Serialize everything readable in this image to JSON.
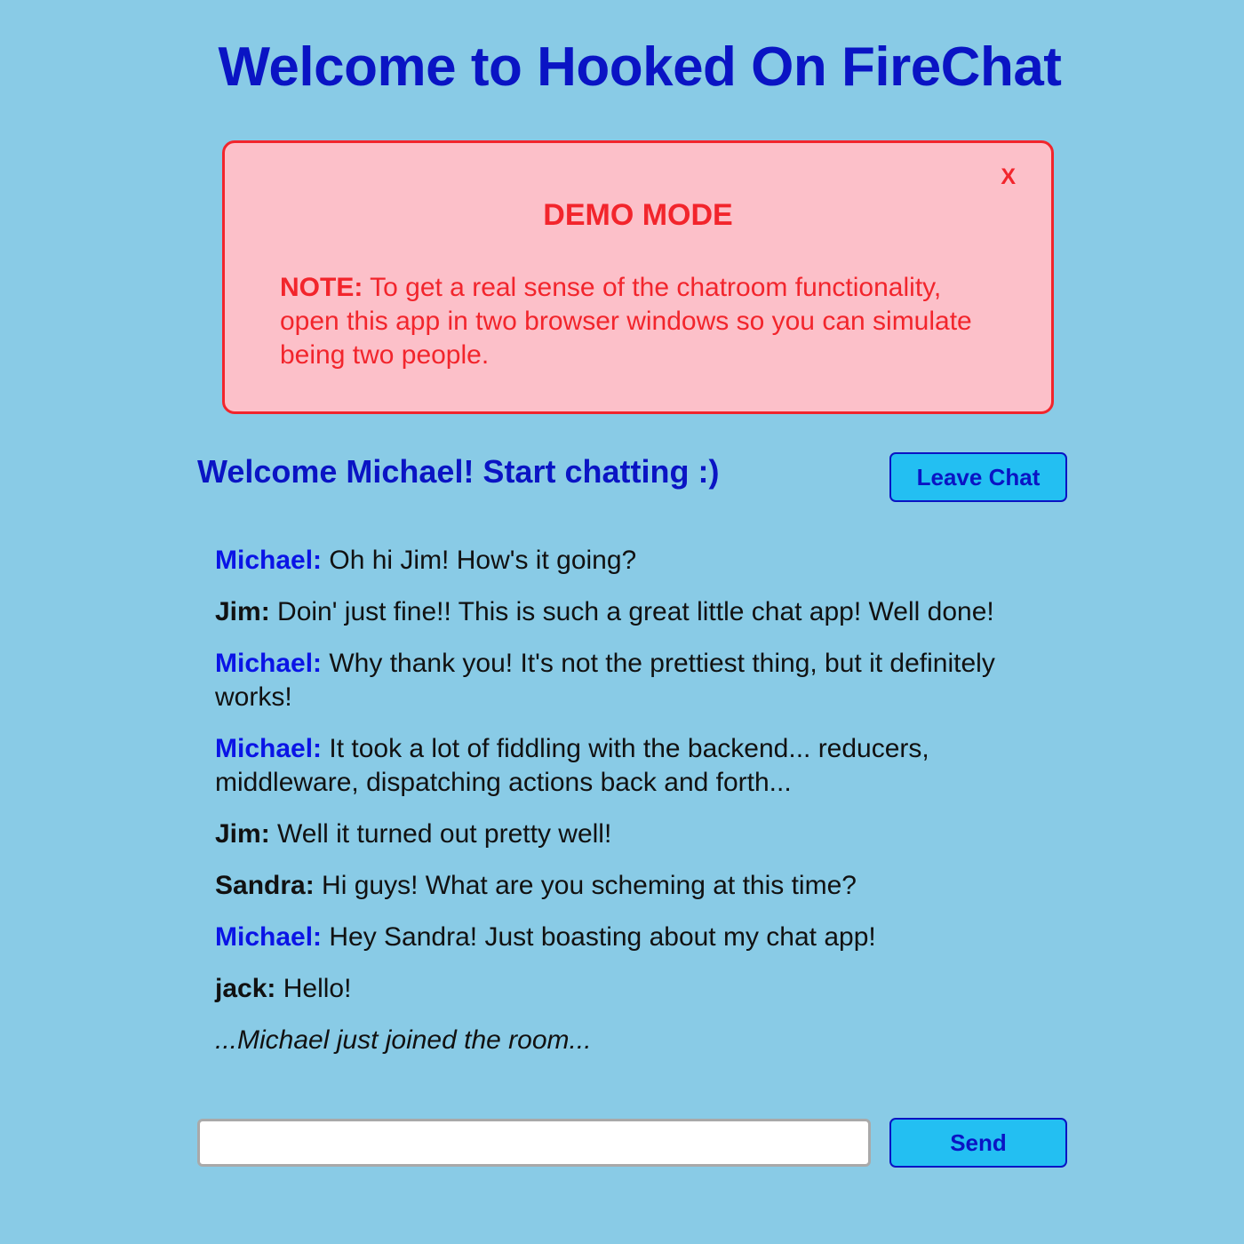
{
  "header": {
    "title": "Welcome to Hooked On FireChat"
  },
  "demo_notice": {
    "close_label": "X",
    "title": "DEMO MODE",
    "note_label": "NOTE:",
    "note_text": " To get a real sense of the chatroom functionality, open this app in two browser windows so you can simulate being two people."
  },
  "chat": {
    "welcome": "Welcome Michael! Start chatting :)",
    "leave_label": "Leave Chat",
    "send_label": "Send",
    "input_value": "",
    "input_placeholder": "",
    "messages": [
      {
        "author": "Michael:",
        "text": " Oh hi Jim! How's it going?",
        "self": true
      },
      {
        "author": "Jim:",
        "text": " Doin' just fine!! This is such a great little chat app! Well done!",
        "self": false
      },
      {
        "author": "Michael:",
        "text": " Why thank you! It's not the prettiest thing, but it definitely works!",
        "self": true
      },
      {
        "author": "Michael:",
        "text": " It took a lot of fiddling with the backend... reducers, middleware, dispatching actions back and forth...",
        "self": true
      },
      {
        "author": "Jim:",
        "text": " Well it turned out pretty well!",
        "self": false
      },
      {
        "author": "Sandra:",
        "text": " Hi guys! What are you scheming at this time?",
        "self": false
      },
      {
        "author": "Michael:",
        "text": " Hey Sandra! Just boasting about my chat app!",
        "self": true
      },
      {
        "author": "jack:",
        "text": " Hello!",
        "self": false
      }
    ],
    "system_message": "...Michael just joined the room..."
  },
  "colors": {
    "background": "#89cbe6",
    "primary": "#0a14c4",
    "alert": "#f2252c",
    "alert_bg": "#fcc0c9",
    "button_bg": "#23bff2"
  }
}
